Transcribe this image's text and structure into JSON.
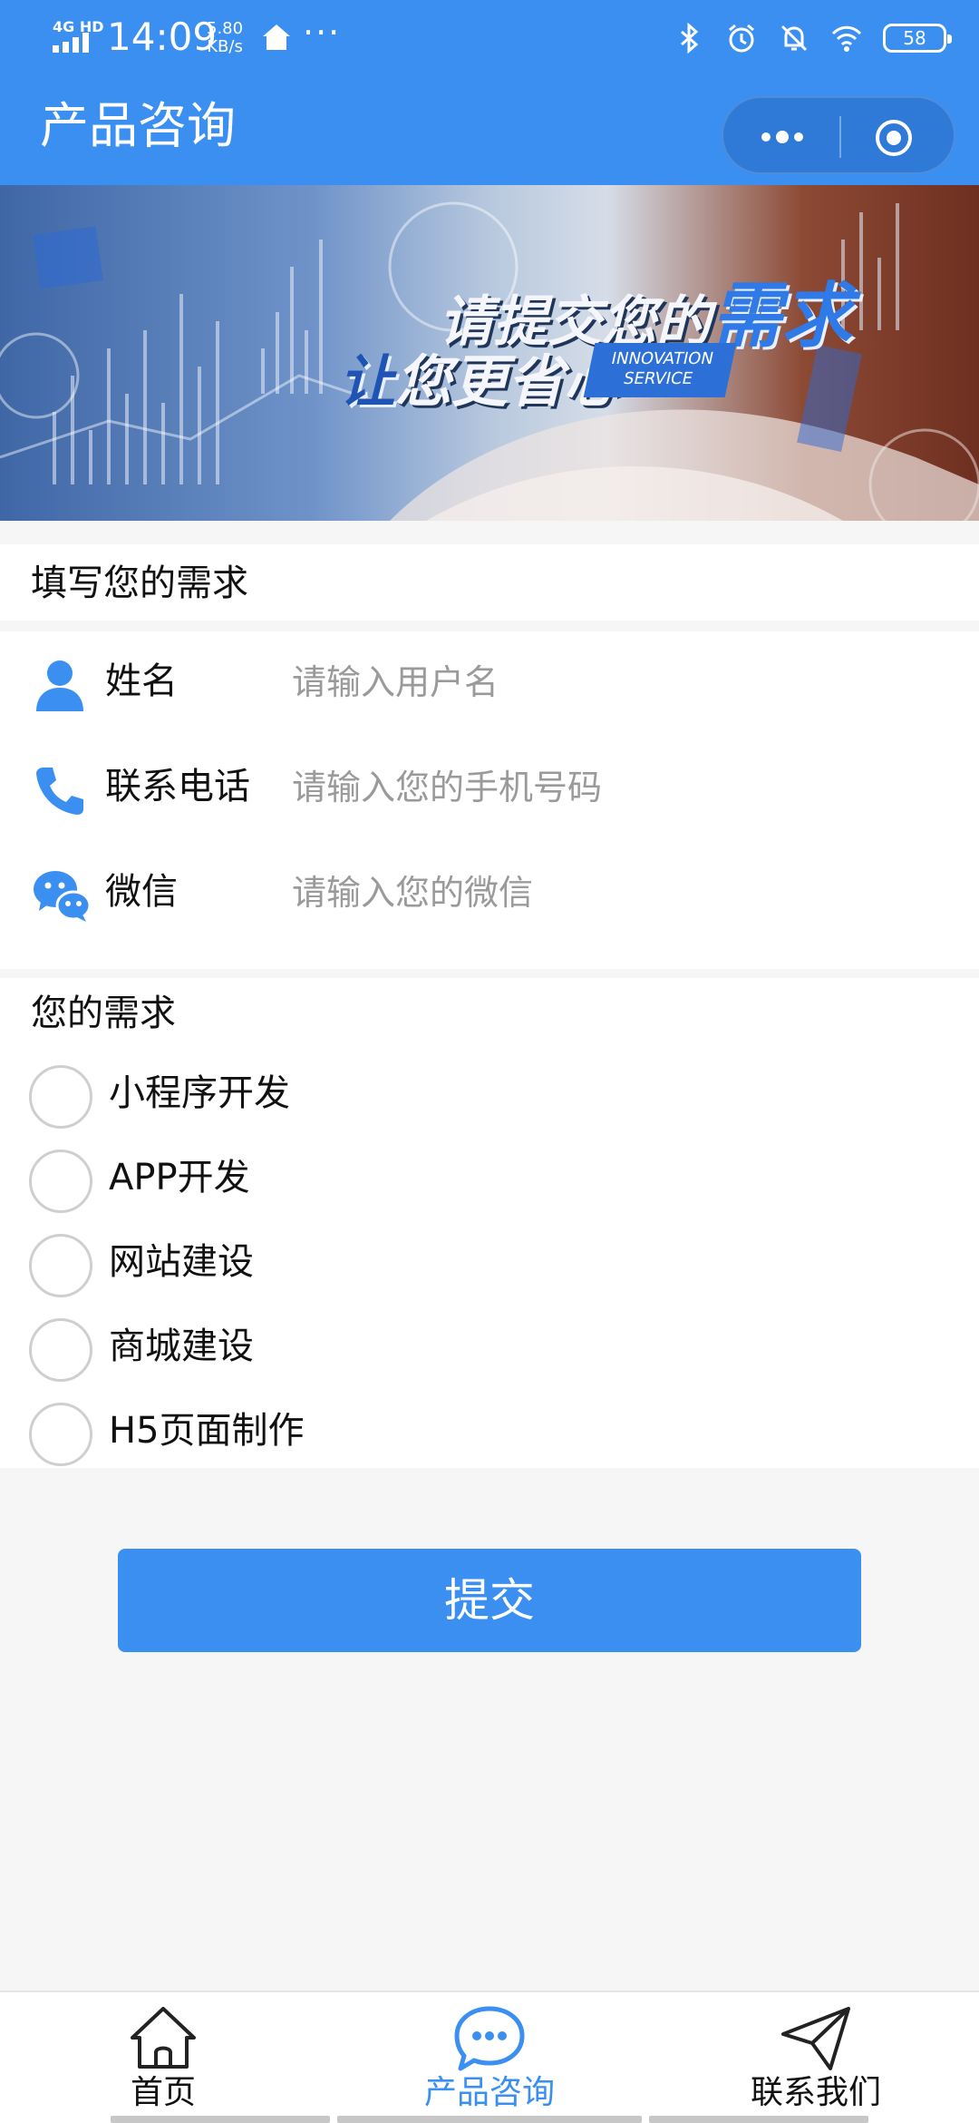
{
  "status_bar": {
    "network": "4G HD",
    "time": "14:09",
    "speed_value": "5.80",
    "speed_unit": "KB/s",
    "overflow": "···",
    "battery": "58",
    "icons": [
      "bluetooth-icon",
      "alarm-icon",
      "mute-icon",
      "wifi-icon"
    ]
  },
  "header": {
    "title": "产品咨询"
  },
  "banner": {
    "line1_main": "请提交您的",
    "line1_highlight": "需求",
    "line2_highlight": "让",
    "line2_main": "您更省心",
    "tag_line1": "INNOVATION",
    "tag_line2": "SERVICE"
  },
  "form": {
    "section_title": "填写您的需求",
    "fields": [
      {
        "label": "姓名",
        "placeholder": "请输入用户名",
        "value": ""
      },
      {
        "label": "联系电话",
        "placeholder": "请输入您的手机号码",
        "value": ""
      },
      {
        "label": "微信",
        "placeholder": "请输入您的微信",
        "value": ""
      }
    ]
  },
  "needs": {
    "title": "您的需求",
    "options": [
      "小程序开发",
      "APP开发",
      "网站建设",
      "商城建设",
      "H5页面制作"
    ]
  },
  "submit_label": "提交",
  "tabbar": {
    "items": [
      {
        "label": "首页",
        "icon": "home-icon",
        "active": false
      },
      {
        "label": "产品咨询",
        "icon": "chat-icon",
        "active": true
      },
      {
        "label": "联系我们",
        "icon": "send-icon",
        "active": false
      }
    ]
  },
  "colors": {
    "primary": "#3a8ff0",
    "background": "#f6f6f6",
    "placeholder": "#9a9a9a"
  }
}
